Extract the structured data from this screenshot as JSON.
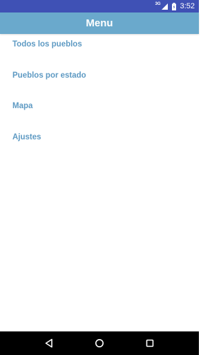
{
  "status_bar": {
    "network": "3G",
    "time": "3:52",
    "icons": [
      "signal-icon",
      "battery-icon"
    ]
  },
  "app_bar": {
    "title": "Menu"
  },
  "menu": {
    "items": [
      {
        "label": "Todos los pueblos"
      },
      {
        "label": "Pueblos por estado"
      },
      {
        "label": "Mapa"
      },
      {
        "label": "Ajustes"
      }
    ]
  },
  "nav_bar": {
    "icons": [
      "back-icon",
      "home-icon",
      "recents-icon"
    ]
  },
  "colors": {
    "status_bar": "#3f51b5",
    "app_bar": "#6aa9cc",
    "menu_text": "#5e9ac3",
    "nav_bar": "#000000"
  }
}
